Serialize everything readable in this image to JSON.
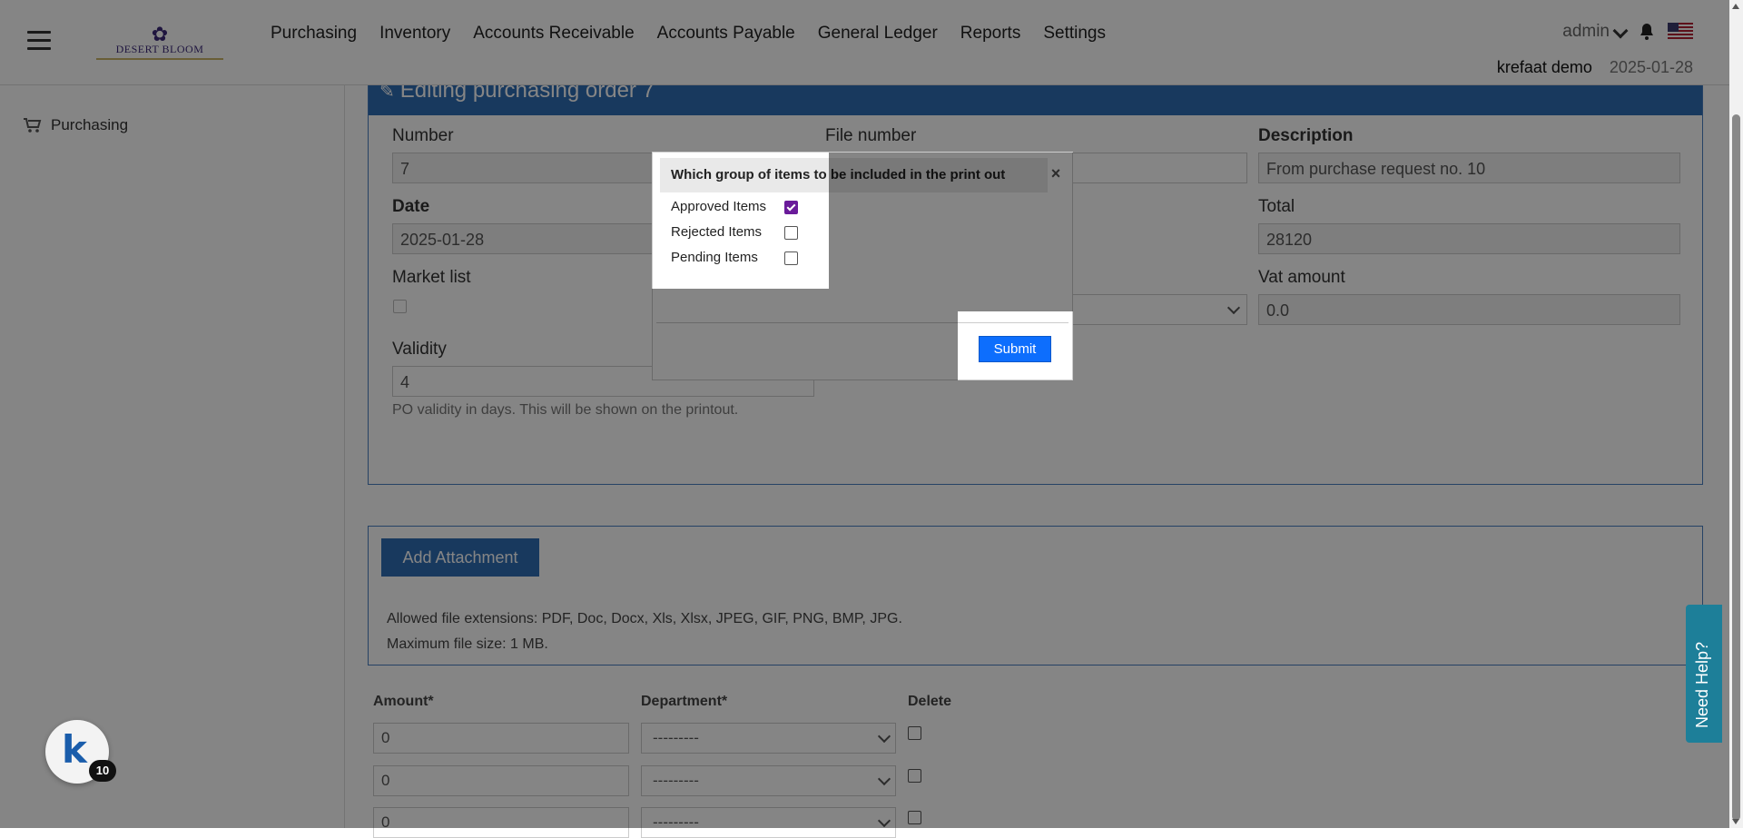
{
  "navbar": {
    "logo_text": "DESERT BLOOM",
    "menu": [
      "Purchasing",
      "Inventory",
      "Accounts Receivable",
      "Accounts Payable",
      "General Ledger",
      "Reports",
      "Settings"
    ],
    "user": "admin",
    "company": "krefaat demo",
    "date": "2025-01-28"
  },
  "sidebar": {
    "items": [
      {
        "label": "Purchasing",
        "icon": "cart-icon"
      }
    ]
  },
  "form": {
    "header": "Editing purchasing order 7",
    "number_label": "Number",
    "number_value": "7",
    "file_number_label": "File number",
    "description_label": "Description",
    "description_value": "From purchase request no. 10",
    "date_label": "Date",
    "date_value": "2025-01-28",
    "total_label": "Total",
    "total_value": "28120",
    "market_list_label": "Market list",
    "vat_label": "Vat amount",
    "vat_value": "0.0",
    "validity_label": "Validity",
    "validity_value": "4",
    "validity_help": "PO validity in days. This will be shown on the printout."
  },
  "attachments": {
    "button": "Add Attachment",
    "extensions": "Allowed file extensions: PDF, Doc, Docx, Xls, Xlsx, JPEG, GIF, PNG, BMP, JPG.",
    "max_size": "Maximum file size: 1 MB."
  },
  "rows": {
    "amount_label": "Amount*",
    "department_label": "Department*",
    "delete_label": "Delete",
    "items": [
      {
        "amount": "0",
        "department": "---------"
      },
      {
        "amount": "0",
        "department": "---------"
      },
      {
        "amount": "0",
        "department": "---------"
      }
    ]
  },
  "modal": {
    "title": "Which group of items to be included in the print out",
    "close": "×",
    "options": [
      {
        "label": "Approved Items",
        "checked": true
      },
      {
        "label": "Rejected Items",
        "checked": false
      },
      {
        "label": "Pending Items",
        "checked": false
      }
    ],
    "submit": "Submit"
  },
  "help_tab": "Need Help?",
  "badge_count": "10",
  "colors": {
    "primary": "#2f6db5",
    "submit": "#0d6efd",
    "checked": "#6a1b9a",
    "help": "#1d7f99"
  }
}
